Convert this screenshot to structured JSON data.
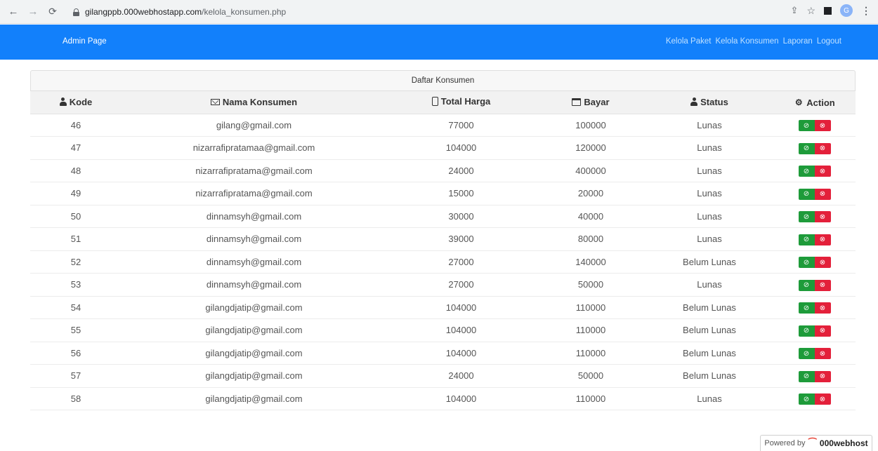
{
  "browser": {
    "url_domain": "gilangppb.000webhostapp.com",
    "url_path": "/kelola_konsumen.php",
    "profile_initial": "G"
  },
  "navbar": {
    "brand": "Admin Page",
    "links": [
      "Kelola Paket",
      "Kelola Konsumen",
      "Laporan",
      "Logout"
    ]
  },
  "panel": {
    "title": "Daftar Konsumen",
    "columns": [
      "Kode",
      "Nama Konsumen",
      "Total Harga",
      "Bayar",
      "Status",
      "Action"
    ],
    "rows": [
      {
        "kode": "46",
        "nama": "gilang@gmail.com",
        "total": "77000",
        "bayar": "100000",
        "status": "Lunas"
      },
      {
        "kode": "47",
        "nama": "nizarrafipratamaa@gmail.com",
        "total": "104000",
        "bayar": "120000",
        "status": "Lunas"
      },
      {
        "kode": "48",
        "nama": "nizarrafipratama@gmail.com",
        "total": "24000",
        "bayar": "400000",
        "status": "Lunas"
      },
      {
        "kode": "49",
        "nama": "nizarrafipratama@gmail.com",
        "total": "15000",
        "bayar": "20000",
        "status": "Lunas"
      },
      {
        "kode": "50",
        "nama": "dinnamsyh@gmail.com",
        "total": "30000",
        "bayar": "40000",
        "status": "Lunas"
      },
      {
        "kode": "51",
        "nama": "dinnamsyh@gmail.com",
        "total": "39000",
        "bayar": "80000",
        "status": "Lunas"
      },
      {
        "kode": "52",
        "nama": "dinnamsyh@gmail.com",
        "total": "27000",
        "bayar": "140000",
        "status": "Belum Lunas"
      },
      {
        "kode": "53",
        "nama": "dinnamsyh@gmail.com",
        "total": "27000",
        "bayar": "50000",
        "status": "Lunas"
      },
      {
        "kode": "54",
        "nama": "gilangdjatip@gmail.com",
        "total": "104000",
        "bayar": "110000",
        "status": "Belum Lunas"
      },
      {
        "kode": "55",
        "nama": "gilangdjatip@gmail.com",
        "total": "104000",
        "bayar": "110000",
        "status": "Belum Lunas"
      },
      {
        "kode": "56",
        "nama": "gilangdjatip@gmail.com",
        "total": "104000",
        "bayar": "110000",
        "status": "Belum Lunas"
      },
      {
        "kode": "57",
        "nama": "gilangdjatip@gmail.com",
        "total": "24000",
        "bayar": "50000",
        "status": "Belum Lunas"
      },
      {
        "kode": "58",
        "nama": "gilangdjatip@gmail.com",
        "total": "104000",
        "bayar": "110000",
        "status": "Lunas"
      }
    ]
  },
  "footer": {
    "powered_by": "Powered by",
    "brand": "000webhost"
  },
  "colors": {
    "navbar": "#1280fb",
    "approve_button": "#1e9b3a",
    "delete_button": "#e3203a"
  },
  "icons": {
    "kode": "user-icon",
    "nama": "envelope-icon",
    "total": "phone-icon",
    "bayar": "calendar-icon",
    "status": "user-icon",
    "action": "gears-icon",
    "approve": "check-circle-icon",
    "delete": "x-circle-icon"
  }
}
